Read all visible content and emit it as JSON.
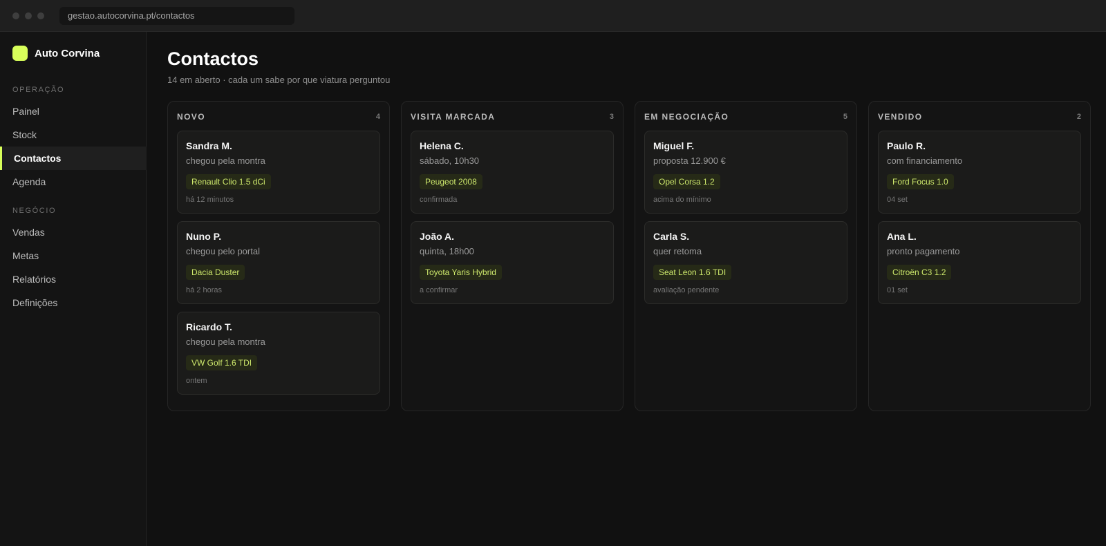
{
  "browser": {
    "url": "gestao.autocorvina.pt/contactos"
  },
  "brand": {
    "name": "Auto Corvina"
  },
  "sidebar": {
    "sections": [
      {
        "label": "OPERAÇÃO",
        "items": [
          {
            "label": "Painel"
          },
          {
            "label": "Stock"
          },
          {
            "label": "Contactos",
            "active": true
          },
          {
            "label": "Agenda"
          }
        ]
      },
      {
        "label": "NEGÓCIO",
        "items": [
          {
            "label": "Vendas"
          },
          {
            "label": "Metas"
          },
          {
            "label": "Relatórios"
          },
          {
            "label": "Definições"
          }
        ]
      }
    ]
  },
  "page": {
    "title": "Contactos",
    "subtitle": "14 em aberto · cada um sabe por que viatura perguntou"
  },
  "board": {
    "columns": [
      {
        "title": "NOVO",
        "count": "4",
        "cards": [
          {
            "name": "Sandra M.",
            "desc": "chegou pela montra",
            "car": "Renault Clio 1.5 dCi",
            "meta": "há 12 minutos"
          },
          {
            "name": "Nuno P.",
            "desc": "chegou pelo portal",
            "car": "Dacia Duster",
            "meta": "há 2 horas"
          },
          {
            "name": "Ricardo T.",
            "desc": "chegou pela montra",
            "car": "VW Golf 1.6 TDI",
            "meta": "ontem"
          }
        ]
      },
      {
        "title": "VISITA MARCADA",
        "count": "3",
        "cards": [
          {
            "name": "Helena C.",
            "desc": "sábado, 10h30",
            "car": "Peugeot 2008",
            "meta": "confirmada"
          },
          {
            "name": "João A.",
            "desc": "quinta, 18h00",
            "car": "Toyota Yaris Hybrid",
            "meta": "a confirmar"
          }
        ]
      },
      {
        "title": "EM NEGOCIAÇÃO",
        "count": "5",
        "cards": [
          {
            "name": "Miguel F.",
            "desc": "proposta 12.900 €",
            "car": "Opel Corsa 1.2",
            "meta": "acima do mínimo"
          },
          {
            "name": "Carla S.",
            "desc": "quer retoma",
            "car": "Seat Leon 1.6 TDI",
            "meta": "avaliação pendente"
          }
        ]
      },
      {
        "title": "VENDIDO",
        "count": "2",
        "cards": [
          {
            "name": "Paulo R.",
            "desc": "com financiamento",
            "car": "Ford Focus 1.0",
            "meta": "04 set"
          },
          {
            "name": "Ana L.",
            "desc": "pronto pagamento",
            "car": "Citroën C3 1.2",
            "meta": "01 set"
          }
        ]
      }
    ]
  },
  "colors": {
    "accent": "#d8ff5a",
    "background": "#111111",
    "card": "#1b1b1a"
  }
}
